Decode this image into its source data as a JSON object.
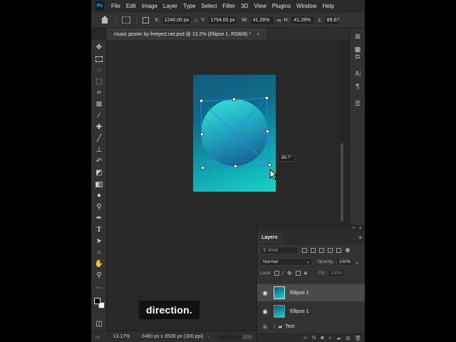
{
  "menubar": {
    "logo": "Ps",
    "items": [
      "File",
      "Edit",
      "Image",
      "Layer",
      "Type",
      "Select",
      "Filter",
      "3D",
      "View",
      "Plugins",
      "Window",
      "Help"
    ]
  },
  "options": {
    "x_label": "X:",
    "x_value": "1240.00 px",
    "y_label": "Y:",
    "y_value": "1754.00 px",
    "w_label": "W:",
    "w_value": "41.28%",
    "h_label": "H:",
    "h_value": "41.28%",
    "angle_value": "89.67"
  },
  "document": {
    "tab_title": "music poster by freeject.net.psd @ 13.2% (Ellipse 1, RGB/8) *",
    "rotation_tip": "89.7°"
  },
  "status": {
    "zoom": "13.17%",
    "doc_size": "2480 px x 3508 px (300 ppi)"
  },
  "caption": "direction.",
  "layers": {
    "tab": "Layers",
    "kind_placeholder": "Kind",
    "blend_mode": "Normal",
    "opacity_label": "Opacity:",
    "opacity_value": "100%",
    "lock_label": "Lock:",
    "fill_label": "Fill:",
    "fill_value": "100%",
    "items": [
      {
        "name": "Ellipse 1",
        "selected": true
      },
      {
        "name": "Ellipse 1",
        "selected": false
      },
      {
        "name": "Text",
        "selected": false
      }
    ]
  }
}
